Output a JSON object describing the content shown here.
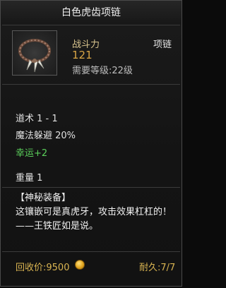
{
  "item": {
    "name": "白色虎齿项链",
    "power_label": "战斗力",
    "power_value": "121",
    "slot_type": "项链",
    "required_level": "需要等级:22级",
    "icon": "tiger-tooth-necklace-icon"
  },
  "stats": {
    "taoism": "道术 1 - 1",
    "magic_evasion": "魔法躲避 20%",
    "luck": "幸运+2",
    "weight": "重量 1"
  },
  "description": {
    "header": "【神秘装备】",
    "text": "这镶嵌可是真虎牙，攻击效果杠杠的！——王铁匠如是说。"
  },
  "footer": {
    "sell_price": "回收价:9500",
    "coin_icon": "gold-coin-icon",
    "durability": "耐久:7/7"
  },
  "colors": {
    "title": "#f0f0f0",
    "power_value": "#d8a545",
    "luck": "#5bd05b",
    "footer": "#d9b451"
  }
}
